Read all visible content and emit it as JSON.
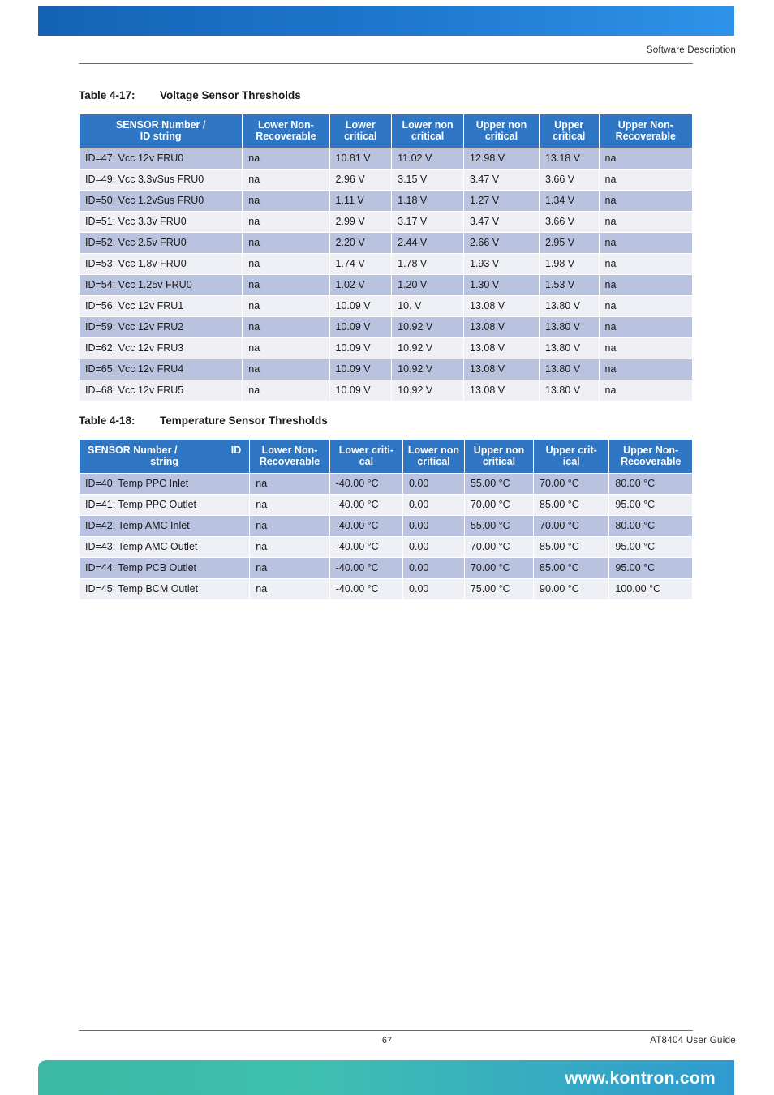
{
  "header": {
    "section": "Software Description"
  },
  "footer": {
    "page_number": "67",
    "doc_title": "AT8404 User  Guide",
    "url": "www.kontron.com"
  },
  "voltage_table": {
    "caption_number": "Table 4-17:",
    "caption_title": "Voltage Sensor Thresholds",
    "headers": [
      "SENSOR Number /\nID string",
      "Lower Non-\nRecoverable",
      "Lower\ncritical",
      "Lower non\ncritical",
      "Upper non\ncritical",
      "Upper\ncritical",
      "Upper Non-\nRecoverable"
    ],
    "headers_lines": [
      [
        "SENSOR Number /",
        "ID string"
      ],
      [
        "Lower Non-",
        "Recoverable"
      ],
      [
        "Lower",
        "critical"
      ],
      [
        "Lower non",
        "critical"
      ],
      [
        "Upper non",
        "critical"
      ],
      [
        "Upper",
        "critical"
      ],
      [
        "Upper Non-",
        "Recoverable"
      ]
    ],
    "rows": [
      [
        "ID=47: Vcc 12v FRU0",
        "na",
        "10.81 V",
        "11.02 V",
        "12.98 V",
        "13.18 V",
        "na"
      ],
      [
        "ID=49: Vcc 3.3vSus FRU0",
        "na",
        "2.96 V",
        "3.15 V",
        "3.47 V",
        "3.66 V",
        "na"
      ],
      [
        "ID=50: Vcc 1.2vSus FRU0",
        "na",
        "1.11 V",
        "1.18 V",
        "1.27 V",
        "1.34 V",
        "na"
      ],
      [
        "ID=51: Vcc 3.3v FRU0",
        "na",
        "2.99 V",
        "3.17 V",
        "3.47 V",
        "3.66 V",
        "na"
      ],
      [
        "ID=52: Vcc 2.5v FRU0",
        "na",
        "2.20 V",
        "2.44 V",
        "2.66 V",
        "2.95 V",
        "na"
      ],
      [
        "ID=53: Vcc 1.8v FRU0",
        "na",
        "1.74 V",
        "1.78 V",
        "1.93 V",
        "1.98 V",
        "na"
      ],
      [
        "ID=54: Vcc 1.25v FRU0",
        "na",
        "1.02 V",
        "1.20 V",
        "1.30 V",
        "1.53 V",
        "na"
      ],
      [
        "ID=56: Vcc 12v FRU1",
        "na",
        "10.09 V",
        "10. V",
        "13.08 V",
        "13.80 V",
        "na"
      ],
      [
        "ID=59: Vcc 12v FRU2",
        "na",
        "10.09 V",
        "10.92 V",
        "13.08 V",
        "13.80 V",
        "na"
      ],
      [
        "ID=62: Vcc 12v FRU3",
        "na",
        "10.09 V",
        "10.92 V",
        "13.08 V",
        "13.80 V",
        "na"
      ],
      [
        "ID=65: Vcc 12v FRU4",
        "na",
        "10.09 V",
        "10.92 V",
        "13.08 V",
        "13.80 V",
        "na"
      ],
      [
        "ID=68: Vcc 12v FRU5",
        "na",
        "10.09 V",
        "10.92 V",
        "13.08 V",
        "13.80 V",
        "na"
      ]
    ]
  },
  "temperature_table": {
    "caption_number": "Table 4-18:",
    "caption_title": "Temperature Sensor Thresholds",
    "headers_lines": [
      [
        "SENSOR Number /",
        "string"
      ],
      [
        "Lower Non-",
        "Recoverable"
      ],
      [
        "Lower criti-",
        "cal"
      ],
      [
        "Lower non",
        "critical"
      ],
      [
        "Upper non",
        "critical"
      ],
      [
        "Upper crit-",
        "ical"
      ],
      [
        "Upper Non-",
        "Recoverable"
      ]
    ],
    "header_id_suffix": "ID",
    "rows": [
      [
        "ID=40: Temp PPC Inlet",
        "na",
        "-40.00 °C",
        "0.00",
        "55.00 °C",
        "70.00 °C",
        "80.00 °C"
      ],
      [
        "ID=41: Temp PPC Outlet",
        "na",
        "-40.00 °C",
        "0.00",
        "70.00 °C",
        "85.00 °C",
        "95.00 °C"
      ],
      [
        "ID=42: Temp AMC Inlet",
        "na",
        "-40.00 °C",
        "0.00",
        "55.00 °C",
        "70.00 °C",
        "80.00 °C"
      ],
      [
        "ID=43: Temp AMC Outlet",
        "na",
        "-40.00 °C",
        "0.00",
        "70.00 °C",
        "85.00 °C",
        "95.00 °C"
      ],
      [
        "ID=44: Temp PCB Outlet",
        "na",
        "-40.00 °C",
        "0.00",
        "70.00 °C",
        "85.00 °C",
        "95.00 °C"
      ],
      [
        "ID=45: Temp BCM Outlet",
        "na",
        "-40.00 °C",
        "0.00",
        "75.00 °C",
        "90.00 °C",
        "100.00 °C"
      ]
    ]
  },
  "colors": {
    "header_blue": "#2f77c4",
    "row_odd": "#b9c3e0",
    "row_even": "#eef0f6",
    "top_bar": "#1f79cf",
    "bottom_bar": "#3fbfb0"
  }
}
